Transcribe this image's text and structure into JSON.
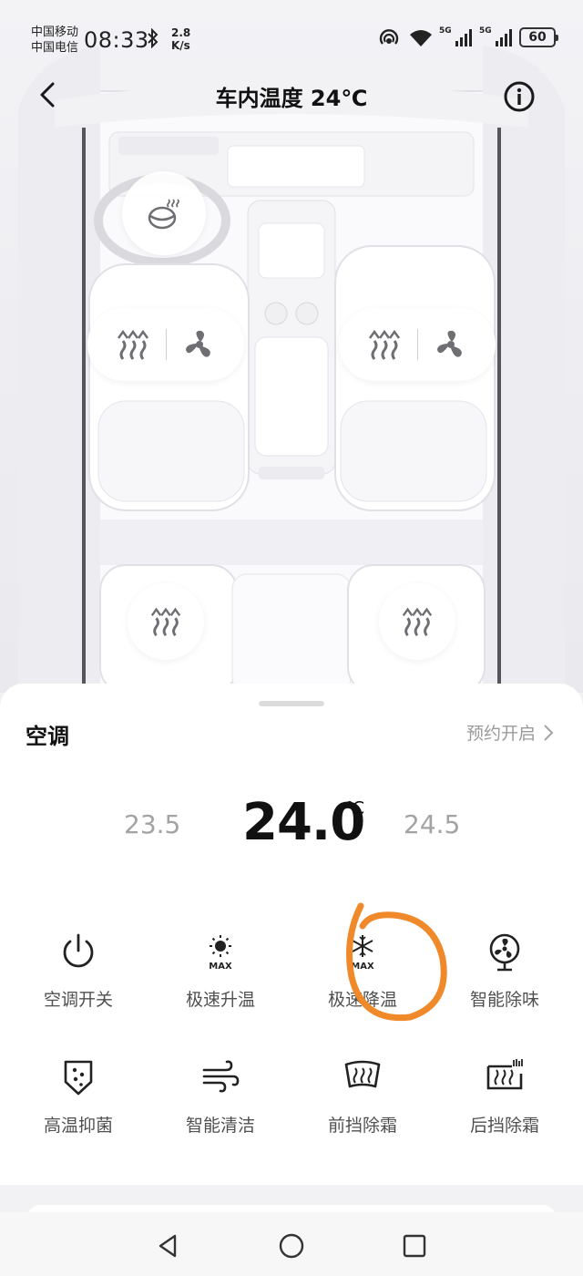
{
  "status_bar": {
    "carrier_1": "中国移动",
    "carrier_2": "中国电信",
    "time": "08:33",
    "net_speed_value": "2.8",
    "net_speed_unit": "K/s",
    "sim1_tag": "5G",
    "sim2_tag": "5G",
    "battery": "60",
    "icons": [
      "bluetooth-icon",
      "hotspot-icon",
      "wifi-icon",
      "signal-icon",
      "battery-icon"
    ]
  },
  "header": {
    "title": "车内温度 24℃",
    "back_icon": "chevron-left-icon",
    "info_icon": "info-icon"
  },
  "car_controls": {
    "steering_heat_icon": "steering-wheel-heat-icon",
    "front_left": [
      "seat-heat-icon",
      "seat-ventilation-icon"
    ],
    "front_right": [
      "seat-heat-icon",
      "seat-ventilation-icon"
    ],
    "rear_left": "seat-heat-icon",
    "rear_right": "seat-heat-icon"
  },
  "climate": {
    "title": "空调",
    "schedule_label": "预约开启",
    "temp_lower": "23.5",
    "temp_current": "24.0",
    "temp_unit": "℃",
    "temp_higher": "24.5",
    "functions": [
      {
        "label": "空调开关",
        "icon": "power-icon"
      },
      {
        "label": "极速升温",
        "icon": "sun-max-icon"
      },
      {
        "label": "极速降温",
        "icon": "snowflake-max-icon"
      },
      {
        "label": "智能除味",
        "icon": "fan-icon"
      },
      {
        "label": "高温抑菌",
        "icon": "shield-sterilize-icon"
      },
      {
        "label": "智能清洁",
        "icon": "wind-icon"
      },
      {
        "label": "前挡除霜",
        "icon": "front-defrost-icon"
      },
      {
        "label": "后挡除霜",
        "icon": "rear-defrost-icon"
      }
    ],
    "icon_text": {
      "max": "MAX"
    },
    "annotation_color": "#f0892a"
  },
  "nav_bar": {
    "icons": [
      "back-triangle-icon",
      "home-circle-icon",
      "recents-square-icon"
    ]
  }
}
